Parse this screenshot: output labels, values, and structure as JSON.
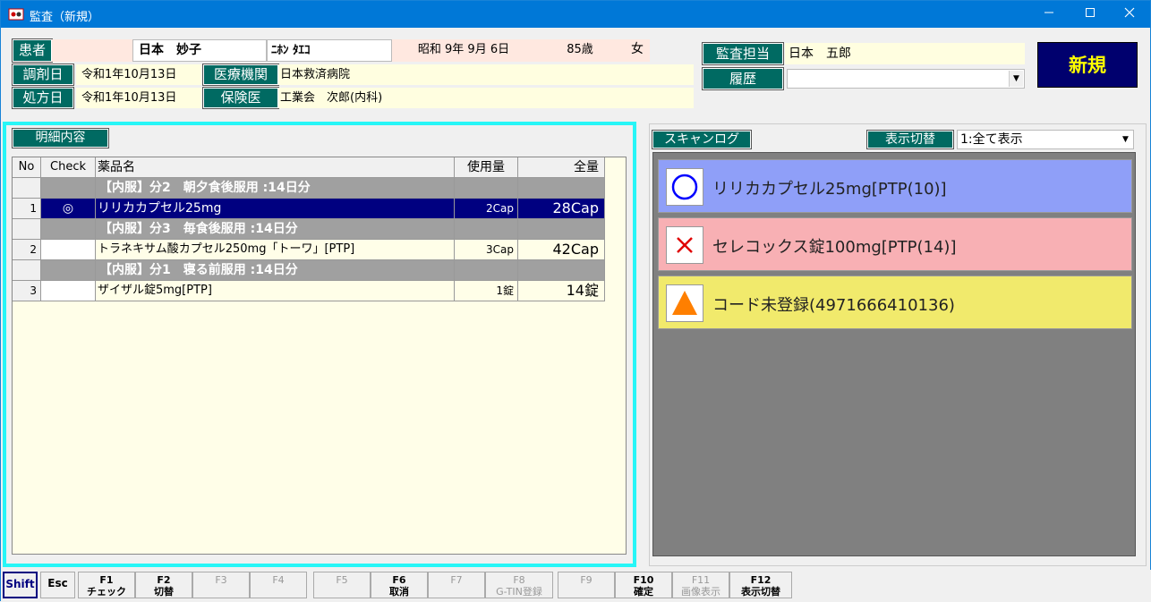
{
  "window": {
    "title": "監査（新規）"
  },
  "patient": {
    "label": "患者",
    "name": "日本　妙子",
    "kana": "ﾆﾎﾝ ﾀｴｺ",
    "birth": "昭和 9年 9月 6日",
    "age": "85歳",
    "sex": "女"
  },
  "dispense": {
    "label": "調剤日",
    "value": "令和1年10月13日"
  },
  "prescribe": {
    "label": "処方日",
    "value": "令和1年10月13日"
  },
  "institution": {
    "label": "医療機関",
    "value": "日本救済病院"
  },
  "doctor": {
    "label": "保険医",
    "value": "工業会　次郎(内科)"
  },
  "auditor": {
    "label": "監査担当",
    "value": "日本　五郎"
  },
  "history": {
    "label": "履歴",
    "value": ""
  },
  "new_button": "新規",
  "detail": {
    "label": "明細内容",
    "columns": [
      "No",
      "Check",
      "薬品名",
      "使用量",
      "全量"
    ],
    "rows": [
      {
        "type": "group",
        "name": "【内服】分2　朝夕食後服用 :14日分"
      },
      {
        "type": "item",
        "no": "1",
        "check": "◎",
        "name": "リリカカプセル25mg",
        "dose": "2Cap",
        "total": "28Cap",
        "selected": true
      },
      {
        "type": "group",
        "name": "【内服】分3　毎食後服用 :14日分"
      },
      {
        "type": "item",
        "no": "2",
        "check": "",
        "name": "トラネキサム酸カプセル250mg「トーワ」[PTP]",
        "dose": "3Cap",
        "total": "42Cap"
      },
      {
        "type": "group",
        "name": "【内服】分1　寝る前服用 :14日分"
      },
      {
        "type": "item",
        "no": "3",
        "check": "",
        "name": "ザイザル錠5mg[PTP]",
        "dose": "1錠",
        "total": "14錠"
      }
    ]
  },
  "scanlog": {
    "label": "スキャンログ",
    "filter_label": "表示切替",
    "filter_value": "1:全て表示",
    "items": [
      {
        "icon": "circle-icon",
        "text": "リリカカプセル25mg[PTP(10)]",
        "bg": "#8f9ff8"
      },
      {
        "icon": "cross-icon",
        "text": "セレコックス錠100mg[PTP(14)]",
        "bg": "#f8b0b4"
      },
      {
        "icon": "triangle-icon",
        "text": "コード未登録(4971666410136)",
        "bg": "#f1ea6c"
      }
    ]
  },
  "fkeys": [
    {
      "id": "shift",
      "l1": "Shift",
      "l2": ""
    },
    {
      "id": "esc",
      "l1": "Esc",
      "l2": ""
    },
    {
      "id": "f1",
      "l1": "F1",
      "l2": "チェック"
    },
    {
      "id": "f2",
      "l1": "F2",
      "l2": "切替"
    },
    {
      "id": "f3",
      "l1": "F3",
      "l2": ""
    },
    {
      "id": "f4",
      "l1": "F4",
      "l2": ""
    },
    {
      "id": "f5",
      "l1": "F5",
      "l2": ""
    },
    {
      "id": "f6",
      "l1": "F6",
      "l2": "取消"
    },
    {
      "id": "f7",
      "l1": "F7",
      "l2": ""
    },
    {
      "id": "f8",
      "l1": "F8",
      "l2": "G-TIN登録"
    },
    {
      "id": "f9",
      "l1": "F9",
      "l2": ""
    },
    {
      "id": "f10",
      "l1": "F10",
      "l2": "確定"
    },
    {
      "id": "f11",
      "l1": "F11",
      "l2": "画像表示"
    },
    {
      "id": "f12",
      "l1": "F12",
      "l2": "表示切替"
    }
  ],
  "colors": {
    "accent": "#27f6f7",
    "label_bg": "#006a62",
    "title_bar": "#0078d7"
  }
}
